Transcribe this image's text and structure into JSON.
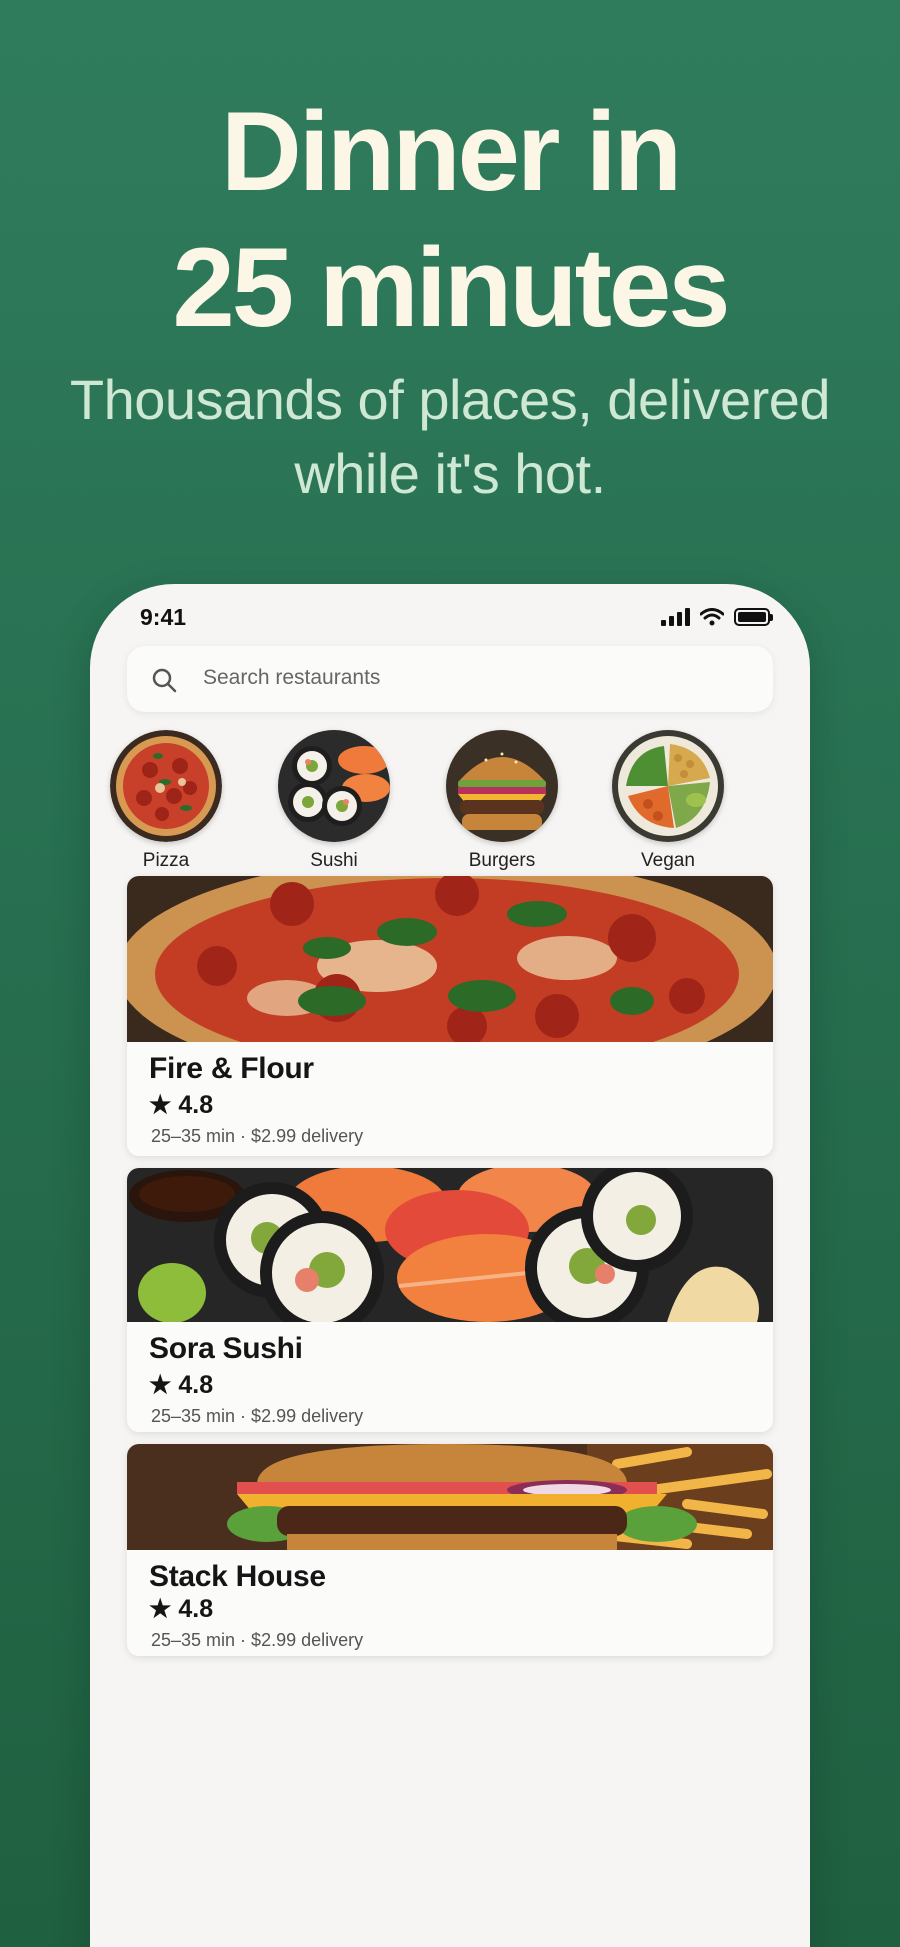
{
  "hero": {
    "headline_line1": "Dinner in",
    "headline_line2": "25 minutes",
    "subline_line1": "Thousands of places, delivered",
    "subline_line2": "while it's hot."
  },
  "status_bar": {
    "time": "9:41"
  },
  "search": {
    "placeholder": "Search restaurants"
  },
  "categories": [
    {
      "label": "Pizza"
    },
    {
      "label": "Sushi"
    },
    {
      "label": "Burgers"
    },
    {
      "label": "Vegan"
    }
  ],
  "restaurants": [
    {
      "name": "Fire & Flour",
      "rating": "★ 4.8",
      "meta": "25–35 min · $2.99 delivery"
    },
    {
      "name": "Sora Sushi",
      "rating": "★ 4.8",
      "meta": "25–35 min · $2.99 delivery"
    },
    {
      "name": "Stack House",
      "rating": "★ 4.8",
      "meta": "25–35 min · $2.99 delivery"
    }
  ],
  "colors": {
    "brand_green": "#2a7455",
    "cream": "#fbf6e6",
    "mint": "#cfe8d3"
  }
}
